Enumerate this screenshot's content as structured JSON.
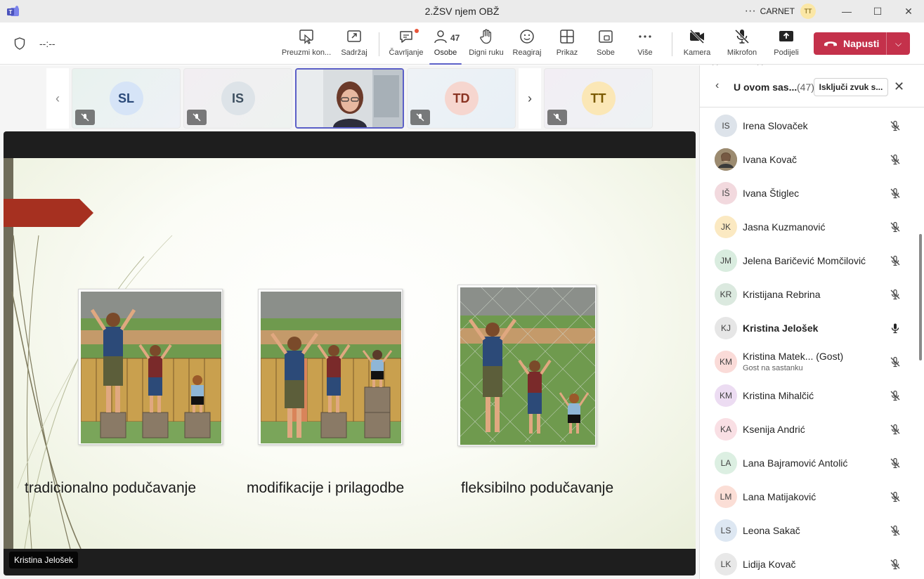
{
  "window": {
    "title": "2.ŽSV njem OBŽ",
    "org": "CARNET",
    "user_initials": "TT",
    "more_icon": "more-horizontal-icon"
  },
  "toolbar": {
    "timer": "--:--",
    "take_control": "Preuzmi kon...",
    "content": "Sadržaj",
    "chat": "Čavrljanje",
    "people": "Osobe",
    "people_count": "47",
    "raise_hand": "Digni ruku",
    "react": "Reagiraj",
    "view": "Prikaz",
    "rooms": "Sobe",
    "more": "Više",
    "camera": "Kamera",
    "mic": "Mikrofon",
    "share": "Podijeli",
    "leave": "Napusti",
    "accent": "#5b5fc7",
    "leave_color": "#c4314b"
  },
  "strip": {
    "tiles": [
      {
        "initials": "SL",
        "bg": "#d6e4f7"
      },
      {
        "initials": "IS",
        "bg": "#dde3e8"
      },
      {
        "initials": "",
        "bg": "#cfd5da"
      },
      {
        "initials": "TD",
        "bg": "#f6d6cf"
      },
      {
        "initials": "TT",
        "bg": "#fbe7b6"
      }
    ]
  },
  "slide": {
    "captions": [
      "tradicionalno podučavanje",
      "modifikacije i prilagodbe",
      "fleksibilno podučavanje"
    ]
  },
  "presenter": "Kristina Jelošek",
  "panel": {
    "title": "U ovom sas...",
    "count": "(47)",
    "mute_all": "Isključi zvuk s...",
    "participants": [
      {
        "initials": "IS",
        "name": "Irena Slovaček",
        "av": "#dde3ea",
        "bold": false,
        "mic": "muted"
      },
      {
        "initials": "",
        "name": "Ivana Kovač",
        "av": "#7a6a55",
        "bold": false,
        "mic": "muted"
      },
      {
        "initials": "IŠ",
        "name": "Ivana Štiglec",
        "av": "#f2d9de",
        "bold": false,
        "mic": "muted"
      },
      {
        "initials": "JK",
        "name": "Jasna Kuzmanović",
        "av": "#fbe9c2",
        "bold": false,
        "mic": "muted"
      },
      {
        "initials": "JM",
        "name": "Jelena Baričević Momčilović",
        "av": "#d9ecdf",
        "bold": false,
        "mic": "muted"
      },
      {
        "initials": "KR",
        "name": "Kristijana Rebrina",
        "av": "#dbe9df",
        "bold": false,
        "mic": "muted"
      },
      {
        "initials": "KJ",
        "name": "Kristina Jelošek",
        "av": "#e6e6e6",
        "bold": true,
        "mic": "on"
      },
      {
        "initials": "KM",
        "name": "Kristina Matek...   (Gost)",
        "sub": "Gost na sastanku",
        "av": "#fadbd8",
        "bold": false,
        "mic": "muted"
      },
      {
        "initials": "KM",
        "name": "Kristina Mihalčić",
        "av": "#ecdcf2",
        "bold": false,
        "mic": "muted"
      },
      {
        "initials": "KA",
        "name": "Ksenija Andrić",
        "av": "#f9dfe4",
        "bold": false,
        "mic": "muted"
      },
      {
        "initials": "LA",
        "name": "Lana Bajramović Antolić",
        "av": "#dcefe2",
        "bold": false,
        "mic": "muted"
      },
      {
        "initials": "LM",
        "name": "Lana Matijaković",
        "av": "#fbded6",
        "bold": false,
        "mic": "muted"
      },
      {
        "initials": "LS",
        "name": "Leona Sakač",
        "av": "#dde7f2",
        "bold": false,
        "mic": "muted"
      },
      {
        "initials": "LK",
        "name": "Lidija Kovač",
        "av": "#e8e8e8",
        "bold": false,
        "mic": "muted"
      }
    ]
  }
}
